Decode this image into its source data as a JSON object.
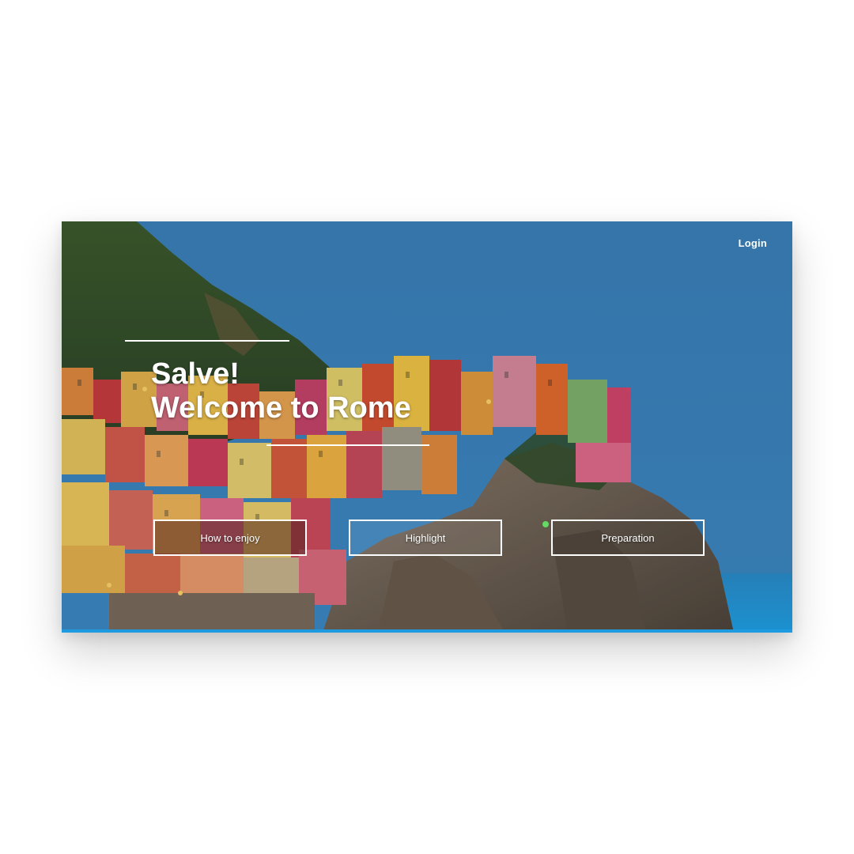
{
  "header": {
    "login_label": "Login"
  },
  "hero": {
    "line1": "Salve!",
    "line2": "Welcome to Rome"
  },
  "nav": {
    "buttons": [
      {
        "label": "How to enjoy"
      },
      {
        "label": "Highlight"
      },
      {
        "label": "Preparation"
      }
    ]
  },
  "colors": {
    "sky": "#3a84bd",
    "sea": "#1e9be0",
    "text": "#ffffff"
  }
}
